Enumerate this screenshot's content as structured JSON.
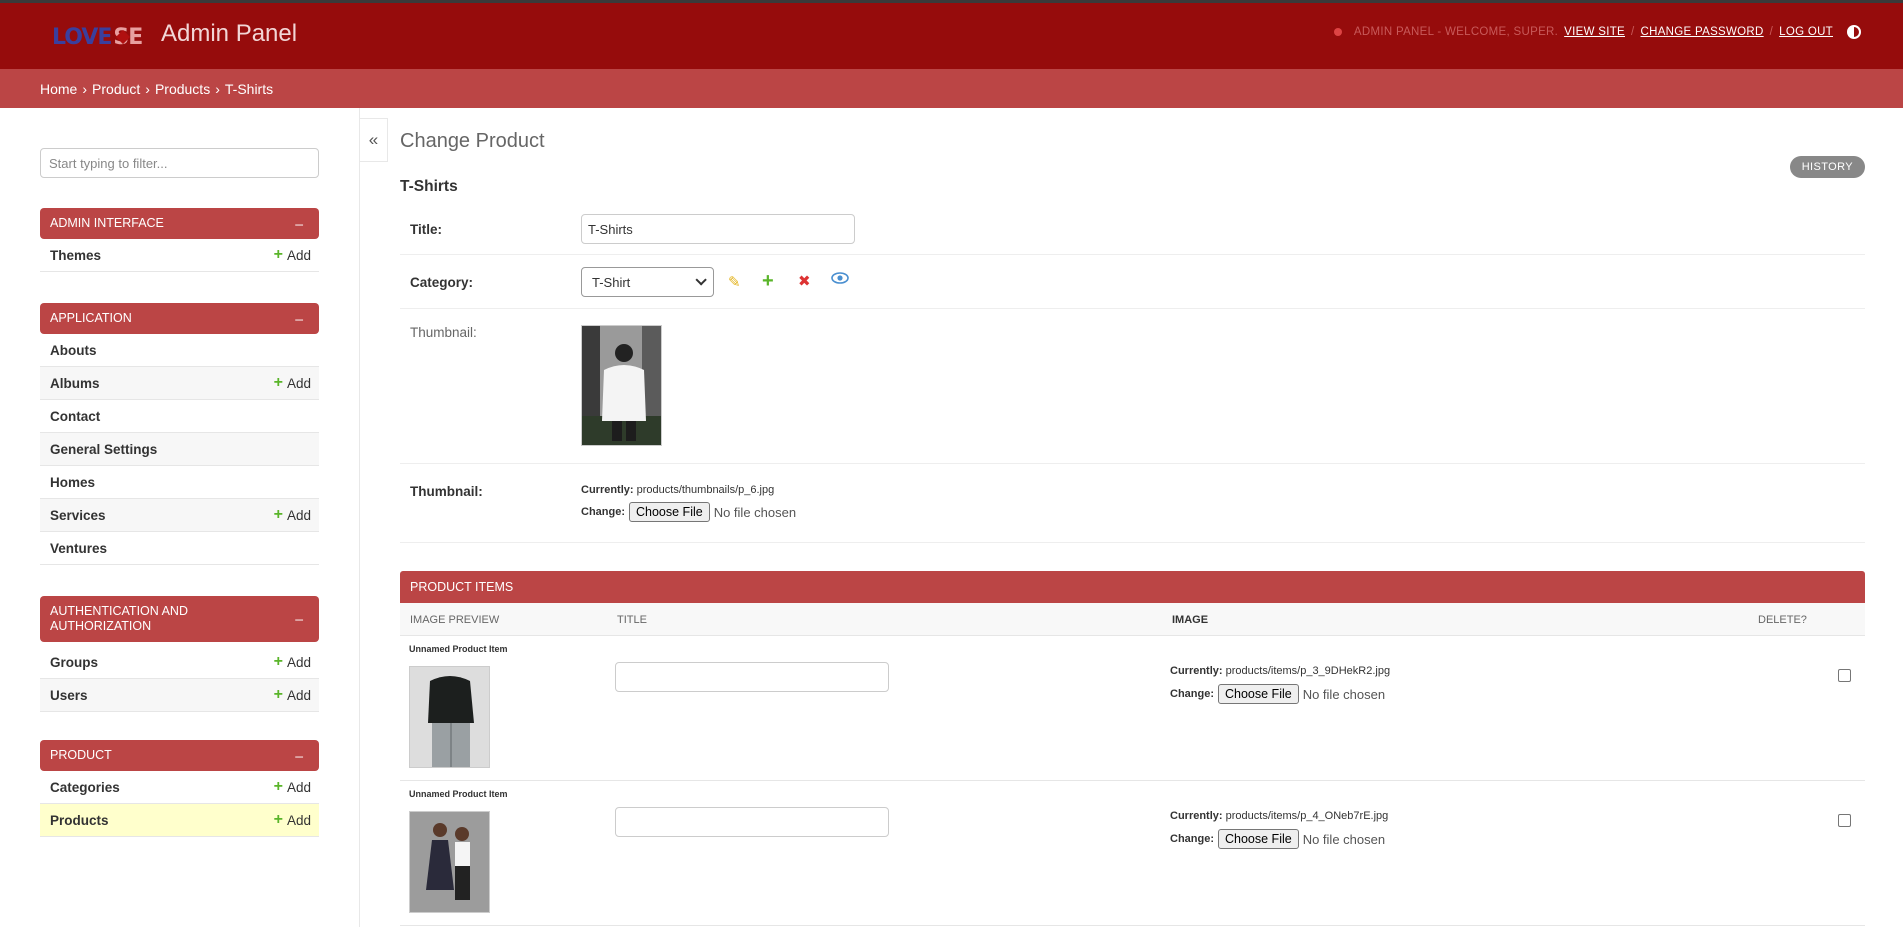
{
  "header": {
    "logo_text_1": "LOVE",
    "logo_text_2": "SE",
    "brand": "Admin Panel",
    "welcome": "ADMIN PANEL - WELCOME, SUPER.",
    "view_site": "VIEW SITE",
    "change_password": "CHANGE PASSWORD",
    "log_out": "LOG OUT",
    "sep": "/"
  },
  "breadcrumb": [
    "Home",
    "Product",
    "Products",
    "T-Shirts"
  ],
  "breadcrumb_sep": "›",
  "sidebar": {
    "filter_placeholder": "Start typing to filter...",
    "collapse_symbol": "–",
    "add_label": "Add",
    "modules": [
      {
        "title": "ADMIN INTERFACE",
        "items": [
          {
            "name": "Themes",
            "add": true
          }
        ]
      },
      {
        "title": "APPLICATION",
        "items": [
          {
            "name": "Abouts",
            "add": false
          },
          {
            "name": "Albums",
            "add": true
          },
          {
            "name": "Contact",
            "add": false
          },
          {
            "name": "General Settings",
            "add": false
          },
          {
            "name": "Homes",
            "add": false
          },
          {
            "name": "Services",
            "add": true
          },
          {
            "name": "Ventures",
            "add": false
          }
        ]
      },
      {
        "title": "AUTHENTICATION AND AUTHORIZATION",
        "items": [
          {
            "name": "Groups",
            "add": true
          },
          {
            "name": "Users",
            "add": true
          }
        ]
      },
      {
        "title": "PRODUCT",
        "items": [
          {
            "name": "Categories",
            "add": true
          },
          {
            "name": "Products",
            "add": true,
            "active": true
          }
        ]
      }
    ]
  },
  "nav_toggle": "«",
  "content": {
    "page_title": "Change Product",
    "history": "HISTORY",
    "object_title": "T-Shirts",
    "title_label": "Title:",
    "title_value": "T-Shirts",
    "category_label": "Category:",
    "category_value": "T-Shirt",
    "thumbnail_preview_label": "Thumbnail:",
    "thumbnail_label": "Thumbnail:",
    "currently_label": "Currently:",
    "thumbnail_path": "products/thumbnails/p_6.jpg",
    "change_label": "Change:",
    "choose_file": "Choose File",
    "no_file": "No file chosen"
  },
  "inline": {
    "header": "PRODUCT ITEMS",
    "columns": {
      "image_preview": "IMAGE PREVIEW",
      "title": "TITLE",
      "image": "IMAGE",
      "delete": "DELETE?"
    },
    "rows": [
      {
        "caption": "Unnamed Product Item",
        "path": "products/items/p_3_9DHekR2.jpg"
      },
      {
        "caption": "Unnamed Product Item",
        "path": "products/items/p_4_ONeb7rE.jpg"
      }
    ]
  },
  "colors": {
    "header": "#960c0c",
    "accent": "#bb4545",
    "add_green": "#5ab52a",
    "active_row": "#ffffcc"
  }
}
